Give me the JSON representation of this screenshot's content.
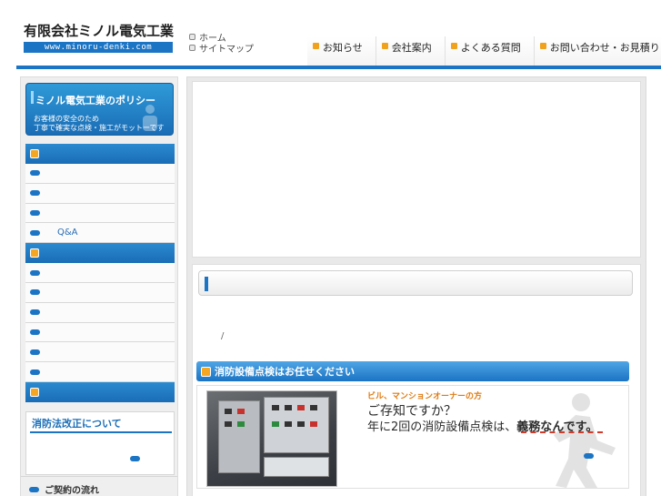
{
  "header": {
    "company": "有限会社ミノル電気工業",
    "url": "www.minoru-denki.com",
    "util_links": [
      "ホーム",
      "サイトマップ"
    ],
    "nav": [
      "お知らせ",
      "会社案内",
      "よくある質問",
      "お問い合わせ・お見積り"
    ]
  },
  "sidebar": {
    "policy_title": "ミノル電気工業のポリシー",
    "policy_sub_1": "お客様の安全のため",
    "policy_sub_2": "丁寧で確実な点検・施工がモットーです",
    "group1_items": [
      "",
      "",
      "",
      "Q&A"
    ],
    "group2_items": [
      "",
      "",
      "",
      "",
      "",
      ""
    ],
    "law_title": "消防法改正について",
    "contract_link": "ご契約の流れ"
  },
  "main": {
    "breadcrumb": "/",
    "section_heading": "消防設備点検はお任せください",
    "promo_kicker": "ビル、マンションオーナーの方",
    "promo_question": "ご存知ですか？",
    "promo_text_prefix": "年に2回の消防設備点検は、",
    "promo_text_emph": "義務なんです。"
  },
  "colors": {
    "brand_blue": "#1b74c4",
    "accent_orange": "#f5a623",
    "promo_orange": "#e07b10"
  }
}
